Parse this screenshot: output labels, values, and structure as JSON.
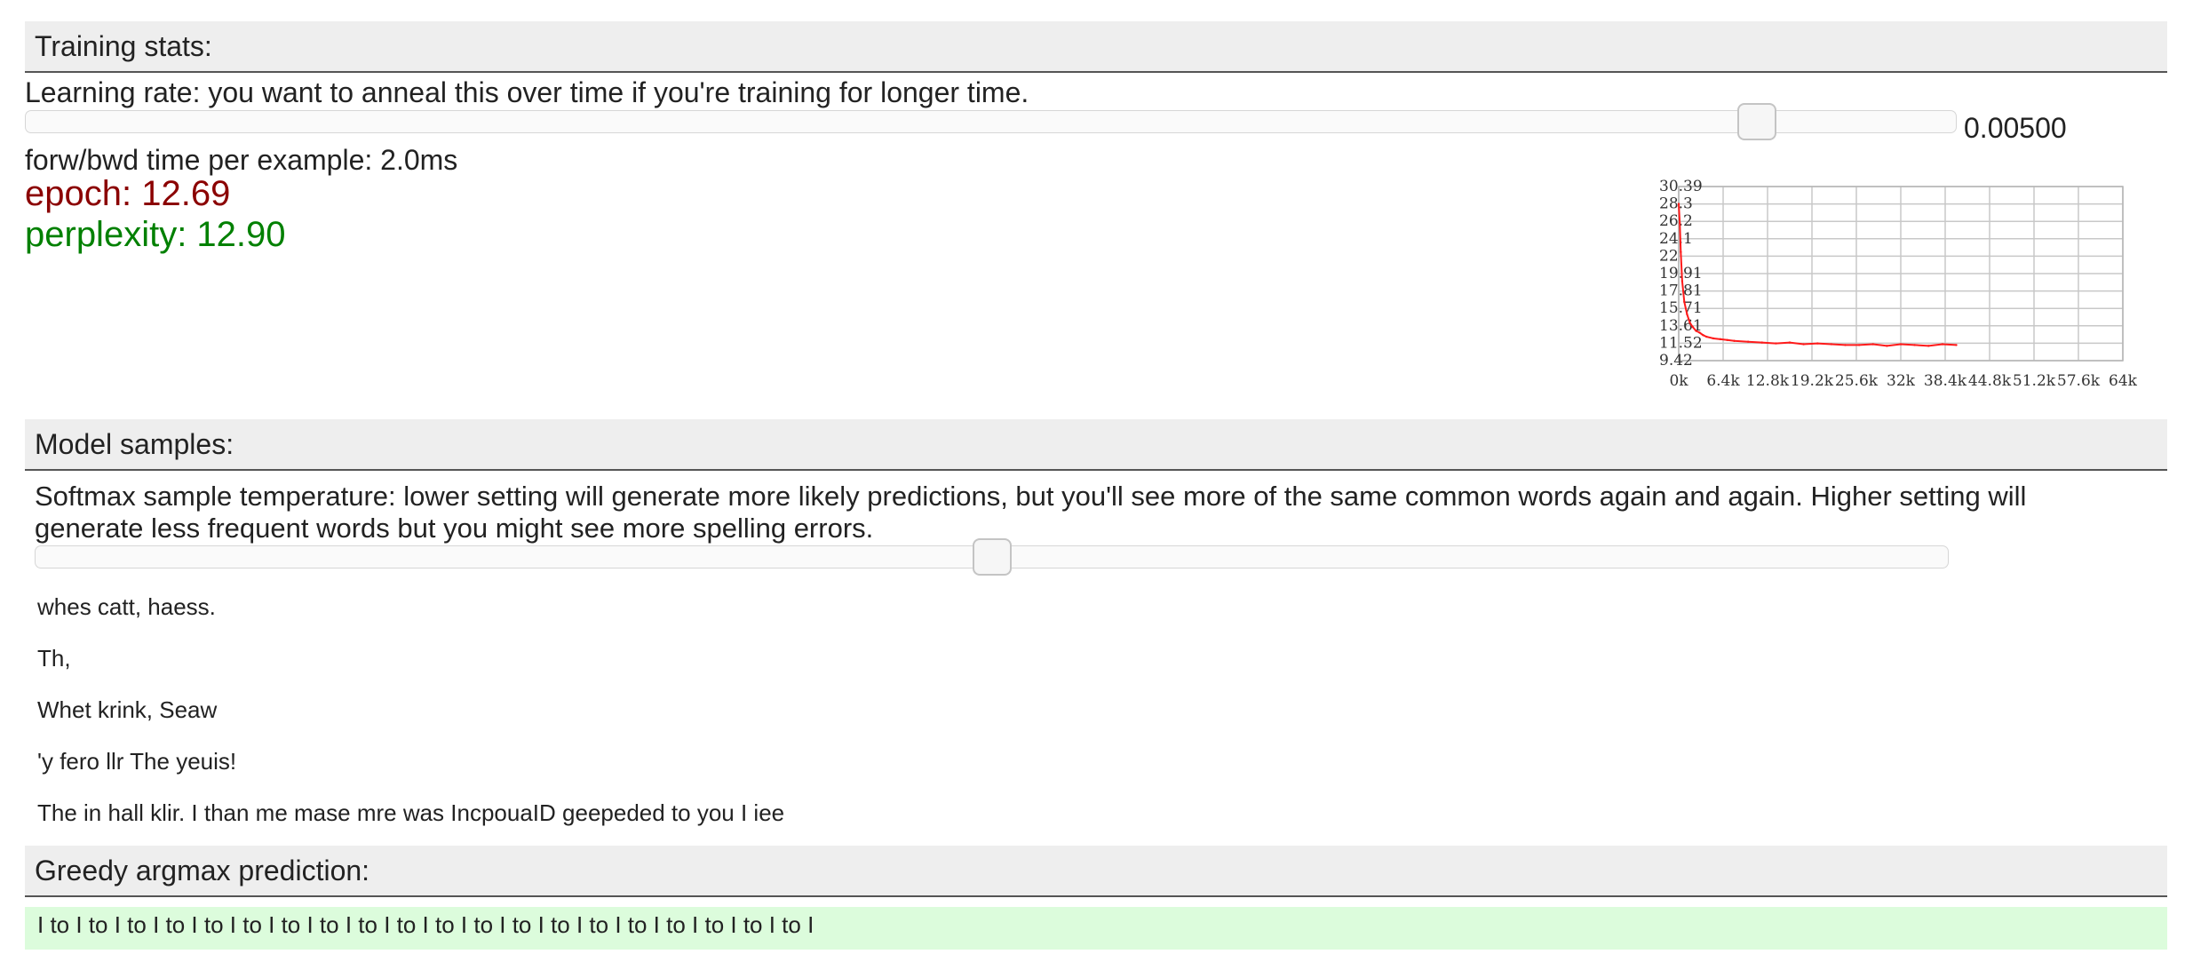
{
  "training": {
    "header": "Training stats:",
    "lr_description": "Learning rate: you want to anneal this over time if you're training for longer time.",
    "lr_value": "0.00500",
    "lr_slider_fraction": 0.905,
    "time_per_example": "forw/bwd time per example: 2.0ms",
    "epoch": "epoch: 12.69",
    "perplexity": "perplexity: 12.90",
    "colors": {
      "epoch": "#8b0000",
      "perplexity": "#008000",
      "line": "#ff1a1a"
    }
  },
  "chart_data": {
    "type": "line",
    "title": "",
    "xlabel": "",
    "ylabel": "",
    "y_ticks": [
      "30.39",
      "28.3",
      "26.2",
      "24.1",
      "22",
      "19.91",
      "17.81",
      "15.71",
      "13.61",
      "11.52",
      "9.42"
    ],
    "x_ticks": [
      "0k",
      "6.4k",
      "12.8k",
      "19.2k",
      "25.6k",
      "32k",
      "38.4k",
      "44.8k",
      "51.2k",
      "57.6k",
      "64k"
    ],
    "ylim": [
      9.42,
      30.39
    ],
    "xlim": [
      0,
      64000
    ],
    "grid": true,
    "series": [
      {
        "x": [
          0,
          150,
          300,
          500,
          800,
          1200,
          1600,
          2000,
          2500,
          3000,
          3500,
          4000,
          5000,
          6000,
          7000,
          8000,
          10000,
          12000,
          14000,
          16000,
          18000,
          20000,
          22000,
          24000,
          26000,
          28000,
          30000,
          32000,
          34000,
          36000,
          38000,
          40000
        ],
        "y": [
          28.3,
          26.0,
          22.5,
          19.0,
          16.5,
          15.0,
          14.0,
          13.5,
          13.0,
          12.8,
          12.5,
          12.3,
          12.1,
          12.0,
          11.9,
          11.8,
          11.7,
          11.6,
          11.5,
          11.6,
          11.4,
          11.5,
          11.4,
          11.3,
          11.3,
          11.4,
          11.2,
          11.4,
          11.3,
          11.2,
          11.4,
          11.3
        ]
      }
    ]
  },
  "samples": {
    "header": "Model samples:",
    "temperature_description_line1": "Softmax sample temperature: lower setting will generate more likely predictions, but you'll see more of the same common words again and again. Higher setting will",
    "temperature_description_line2": "generate less frequent words but you might see more spelling errors.",
    "temperature_slider_fraction": 0.5,
    "lines": [
      "whes catt, haess.",
      "Th,",
      "Whet krink, Seaw",
      "'y fero llr The yeuis!",
      "The in hall klir. I than me mase mre was IncpouaID geepeded to you I iee"
    ]
  },
  "greedy": {
    "header": "Greedy argmax prediction:",
    "text": "I to I to I to I to I to I to I to I to I to I to I to I to I to I to I to I to I to I to I to I to I"
  }
}
